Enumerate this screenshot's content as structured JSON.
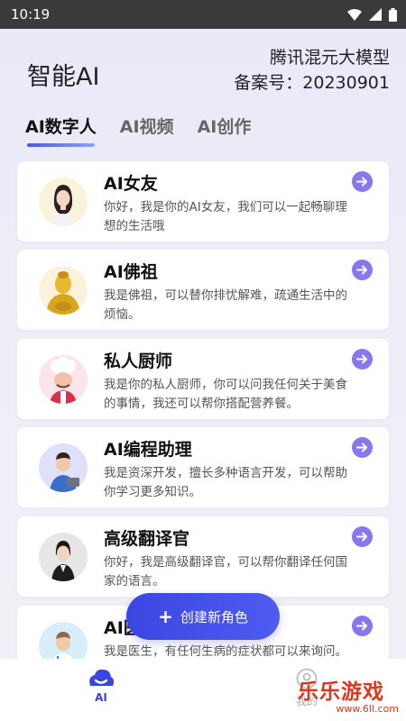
{
  "status_bar": {
    "time": "10:19"
  },
  "header": {
    "app_title": "智能AI",
    "model_name": "腾讯混元大模型",
    "filing_number": "备案号：20230901"
  },
  "tabs": [
    {
      "label": "AI数字人",
      "active": true
    },
    {
      "label": "AI视频",
      "active": false
    },
    {
      "label": "AI创作",
      "active": false
    }
  ],
  "characters": [
    {
      "name": "AI女友",
      "description": "你好，我是你的AI女友，我们可以一起畅聊理想的生活哦",
      "avatar": "girlfriend-avatar"
    },
    {
      "name": "AI佛祖",
      "description": "我是佛祖，可以替你排忧解难，疏通生活中的烦恼。",
      "avatar": "buddha-avatar"
    },
    {
      "name": "私人厨师",
      "description": "我是你的私人厨师，你可以问我任何关于美食的事情，我还可以帮你搭配营养餐。",
      "avatar": "chef-avatar"
    },
    {
      "name": "AI编程助理",
      "description": "我是资深开发，擅长多种语言开发，可以帮助你学习更多知识。",
      "avatar": "programmer-avatar"
    },
    {
      "name": "高级翻译官",
      "description": "你好，我是高级翻译官，可以帮你翻译任何国家的语言。",
      "avatar": "translator-avatar"
    },
    {
      "name": "AI医生",
      "description": "我是医生，有任何生病的症状都可以来询问。",
      "avatar": "doctor-avatar"
    }
  ],
  "create_button": {
    "label": "创建新角色"
  },
  "bottom_nav": {
    "items": [
      {
        "label": "AI",
        "active": true
      },
      {
        "label": "我的",
        "active": false
      }
    ]
  },
  "watermark": {
    "text": "乐乐游戏",
    "url": "www.6ll.com"
  },
  "colors": {
    "accent": "#3a46e0",
    "arrow": "#8877ee",
    "watermark": "#e2361c"
  }
}
